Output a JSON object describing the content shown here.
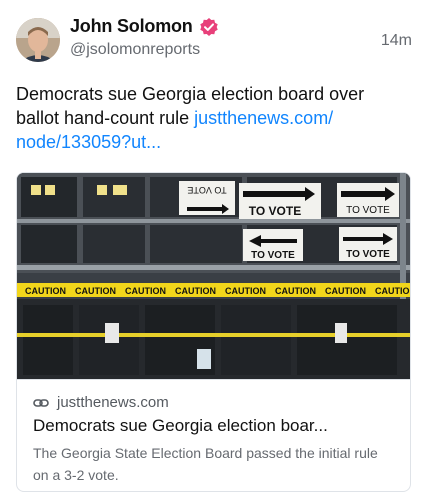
{
  "post": {
    "author": {
      "name": "John Solomon",
      "handle": "@jsolomonreports",
      "verified_color": "#e8407a"
    },
    "time": "14m",
    "text": "Democrats sue Georgia election board over ballot hand-count rule ",
    "link_text": "justthenews.com/\nnode/133059?ut...",
    "card": {
      "domain": "justthenews.com",
      "title": "Democrats sue Georgia election boar...",
      "description": "The Georgia State Election Board passed the initial rule on a 3-2 vote.",
      "image_signs": [
        "TO VOTE",
        "TO VOTE",
        "TO VOTE",
        "TO VOTE",
        "TO VOTE"
      ],
      "tape_text": "CAUTION"
    }
  },
  "colors": {
    "link": "#1185fe",
    "text": "#111111",
    "muted": "#666a70",
    "border": "#dfe3e8"
  }
}
